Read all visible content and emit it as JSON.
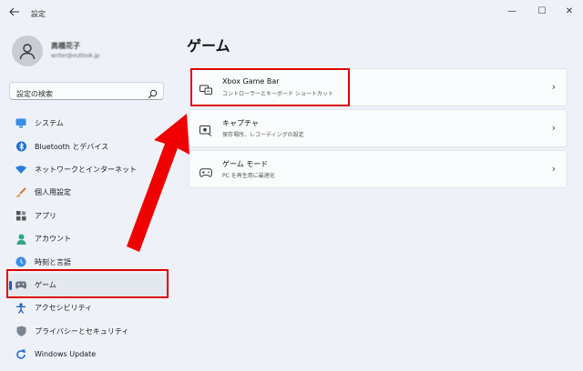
{
  "window": {
    "title": "設定",
    "back_icon": "arrow-left-icon",
    "minimize_label": "—",
    "maximize_label": "☐",
    "close_label": "✕"
  },
  "user": {
    "name": "高橋花子",
    "email": "writer@outlook.jp"
  },
  "search": {
    "placeholder": "設定の検索"
  },
  "sidebar": {
    "items": [
      {
        "label": "システム",
        "icon": "monitor-icon"
      },
      {
        "label": "Bluetooth とデバイス",
        "icon": "bluetooth-icon"
      },
      {
        "label": "ネットワークとインターネット",
        "icon": "wifi-icon"
      },
      {
        "label": "個人用設定",
        "icon": "brush-icon"
      },
      {
        "label": "アプリ",
        "icon": "apps-icon"
      },
      {
        "label": "アカウント",
        "icon": "person-icon"
      },
      {
        "label": "時刻と言語",
        "icon": "globe-clock-icon"
      },
      {
        "label": "ゲーム",
        "icon": "gamepad-icon",
        "active": true
      },
      {
        "label": "アクセシビリティ",
        "icon": "accessibility-icon"
      },
      {
        "label": "プライバシーとセキュリティ",
        "icon": "shield-icon"
      },
      {
        "label": "Windows Update",
        "icon": "update-icon"
      }
    ]
  },
  "main": {
    "title": "ゲーム",
    "cards": [
      {
        "title": "Xbox Game Bar",
        "subtitle": "コントローラーとキーボード ショートカット",
        "icon": "game-bar-icon"
      },
      {
        "title": "キャプチャ",
        "subtitle": "保存場所、レコーディングの設定",
        "icon": "capture-icon"
      },
      {
        "title": "ゲーム モード",
        "subtitle": "PC を再生用に最適化",
        "icon": "game-mode-icon"
      }
    ]
  },
  "colors": {
    "accent": "#0067c0",
    "highlight": "#e00000",
    "background": "#eef2f8"
  }
}
